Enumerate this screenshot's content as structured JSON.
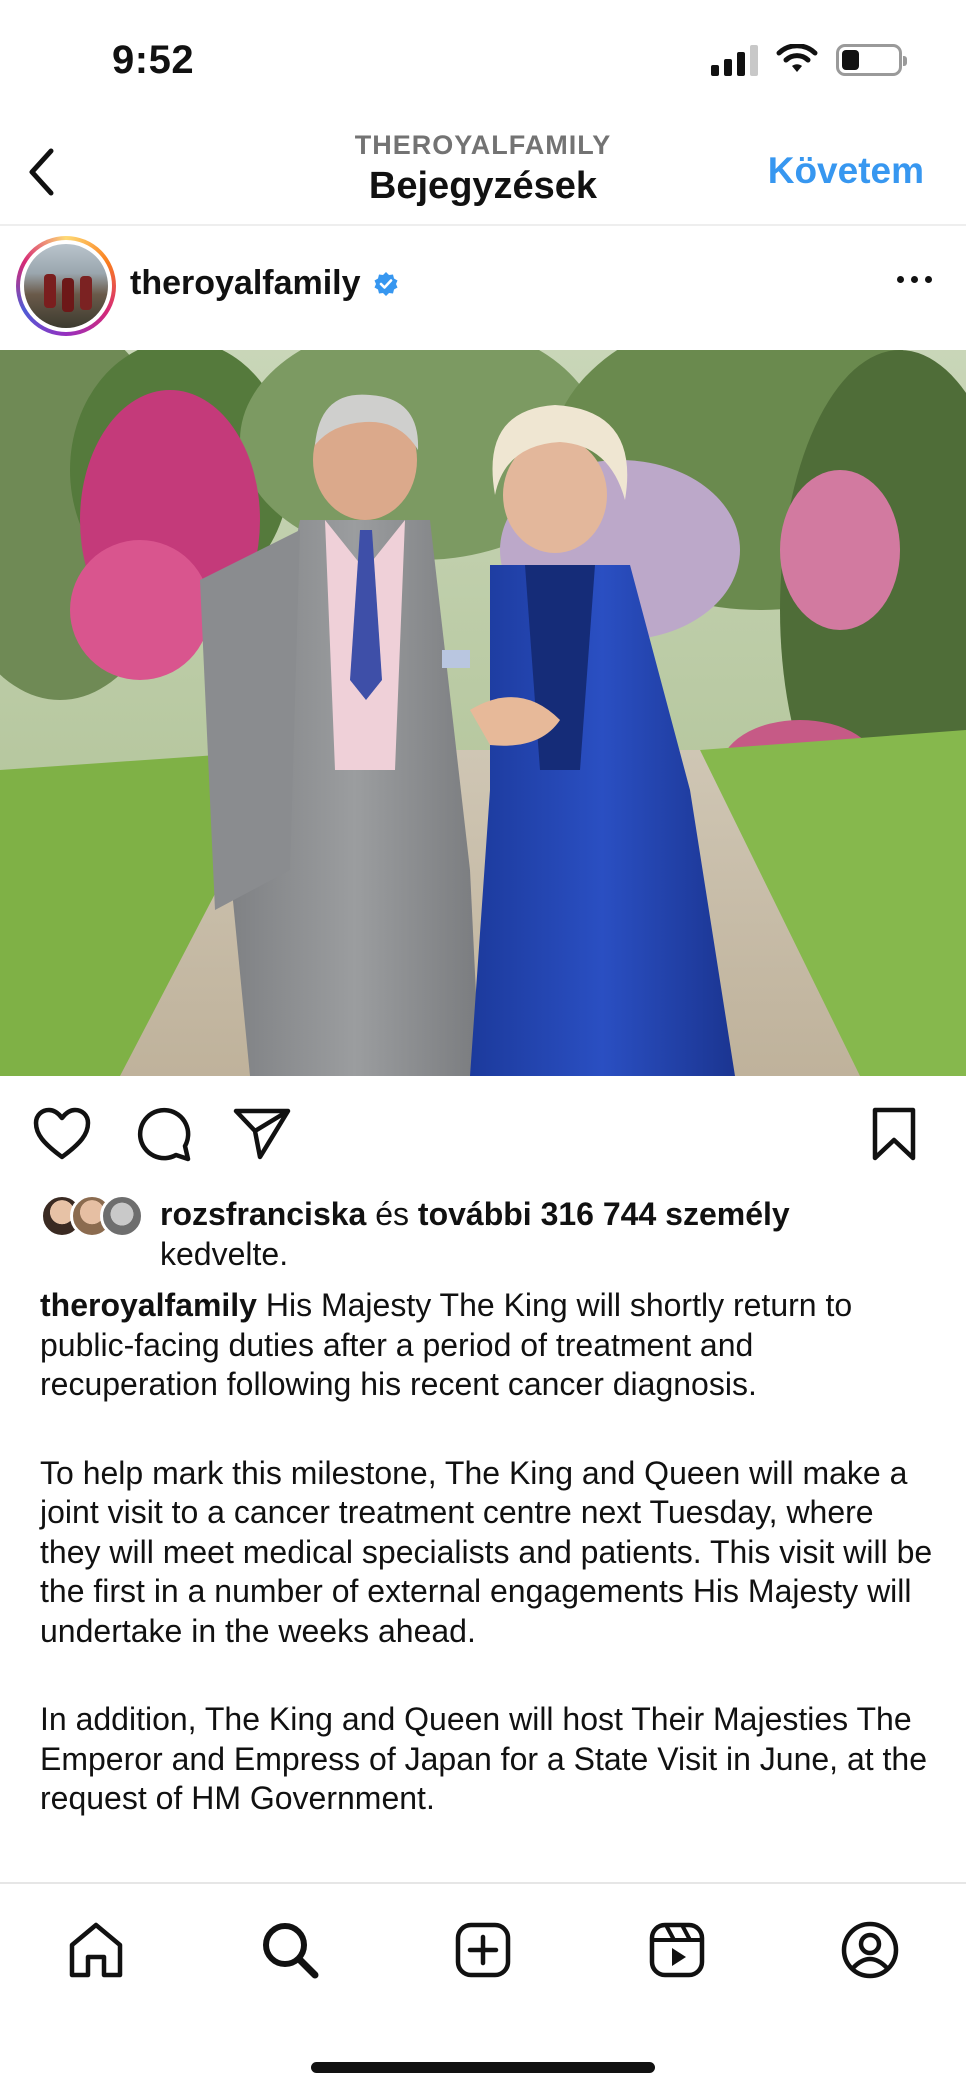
{
  "status_bar": {
    "time": "9:52"
  },
  "header": {
    "subtitle": "THEROYALFAMILY",
    "title": "Bejegyzések",
    "follow_label": "Követem"
  },
  "post": {
    "username": "theroyalfamily",
    "verified": true,
    "likes": {
      "liker": "rozsfranciska",
      "connector": " és ",
      "others": "további 316 744 személy",
      "suffix": "kedvelte."
    },
    "caption": {
      "username": "theroyalfamily",
      "paragraph1": "His Majesty The King will shortly return to public-facing duties after a period of treatment and recuperation following his recent cancer diagnosis.",
      "paragraph2": "To help mark this milestone, The King and Queen will make a joint visit to a cancer treatment centre next Tuesday, where they will meet medical specialists and patients. This visit will be the first in a number of external engagements His Majesty will undertake in the weeks ahead.",
      "paragraph3": "In addition, The King and Queen will host Their Majesties The Emperor and Empress of Japan for a State Visit in June, at the request of HM Government."
    }
  },
  "bottom_nav": {
    "tabs": [
      "home-icon",
      "search-icon",
      "create-icon",
      "reels-icon",
      "profile-icon"
    ]
  },
  "colors": {
    "accent": "#3797f0",
    "text": "#111111",
    "muted": "#737373"
  }
}
